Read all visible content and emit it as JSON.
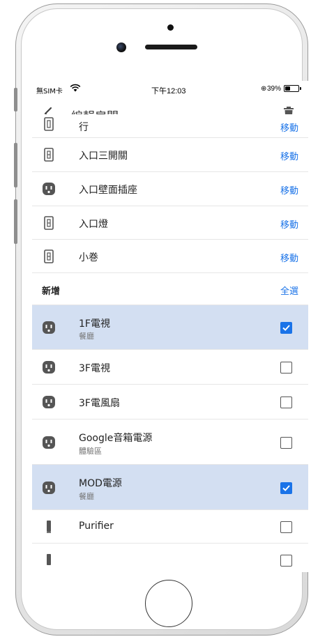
{
  "status_bar": {
    "carrier": "無SIM卡",
    "time": "下午12:03",
    "lock_icon": "⊕",
    "battery_percent": "39%",
    "battery_level": 0.39
  },
  "nav": {
    "title": "編輯房間"
  },
  "room_devices": [
    {
      "name": "行",
      "action": "移動",
      "icon": "switch-icon"
    },
    {
      "name": "入口三開關",
      "action": "移動",
      "icon": "switch-icon"
    },
    {
      "name": "入口壁面插座",
      "action": "移動",
      "icon": "outlet-icon"
    },
    {
      "name": "入口燈",
      "action": "移動",
      "icon": "switch-icon"
    },
    {
      "name": "小巻",
      "action": "移動",
      "icon": "switch-icon"
    }
  ],
  "add_section": {
    "title": "新增",
    "select_all": "全選"
  },
  "add_devices": [
    {
      "name": "1F電視",
      "room": "餐廳",
      "checked": true,
      "icon": "outlet-icon"
    },
    {
      "name": "3F電視",
      "room": "",
      "checked": false,
      "icon": "outlet-icon"
    },
    {
      "name": "3F電風扇",
      "room": "",
      "checked": false,
      "icon": "outlet-icon"
    },
    {
      "name": "Google音箱電源",
      "room": "體驗區",
      "checked": false,
      "icon": "outlet-icon"
    },
    {
      "name": "MOD電源",
      "room": "餐廳",
      "checked": true,
      "icon": "outlet-icon"
    },
    {
      "name": "Purifier",
      "room": "",
      "checked": false,
      "icon": "purifier-icon"
    }
  ]
}
